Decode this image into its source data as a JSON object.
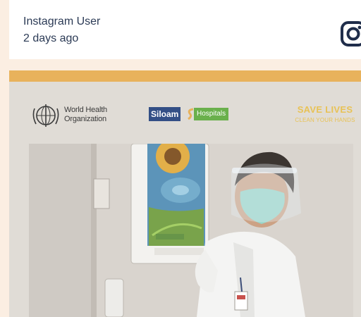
{
  "header": {
    "user_name": "Instagram User",
    "timestamp": "2 days ago",
    "platform_icon": "instagram-icon"
  },
  "post": {
    "accent_color": "#e8b25c",
    "who_logo": {
      "line1": "World Health",
      "line2": "Organization"
    },
    "siloam_logo": {
      "name": "Siloam",
      "suffix": "Hospitals"
    },
    "campaign": {
      "headline": "SAVE LIVES",
      "subline": "CLEAN YOUR HANDS"
    }
  }
}
